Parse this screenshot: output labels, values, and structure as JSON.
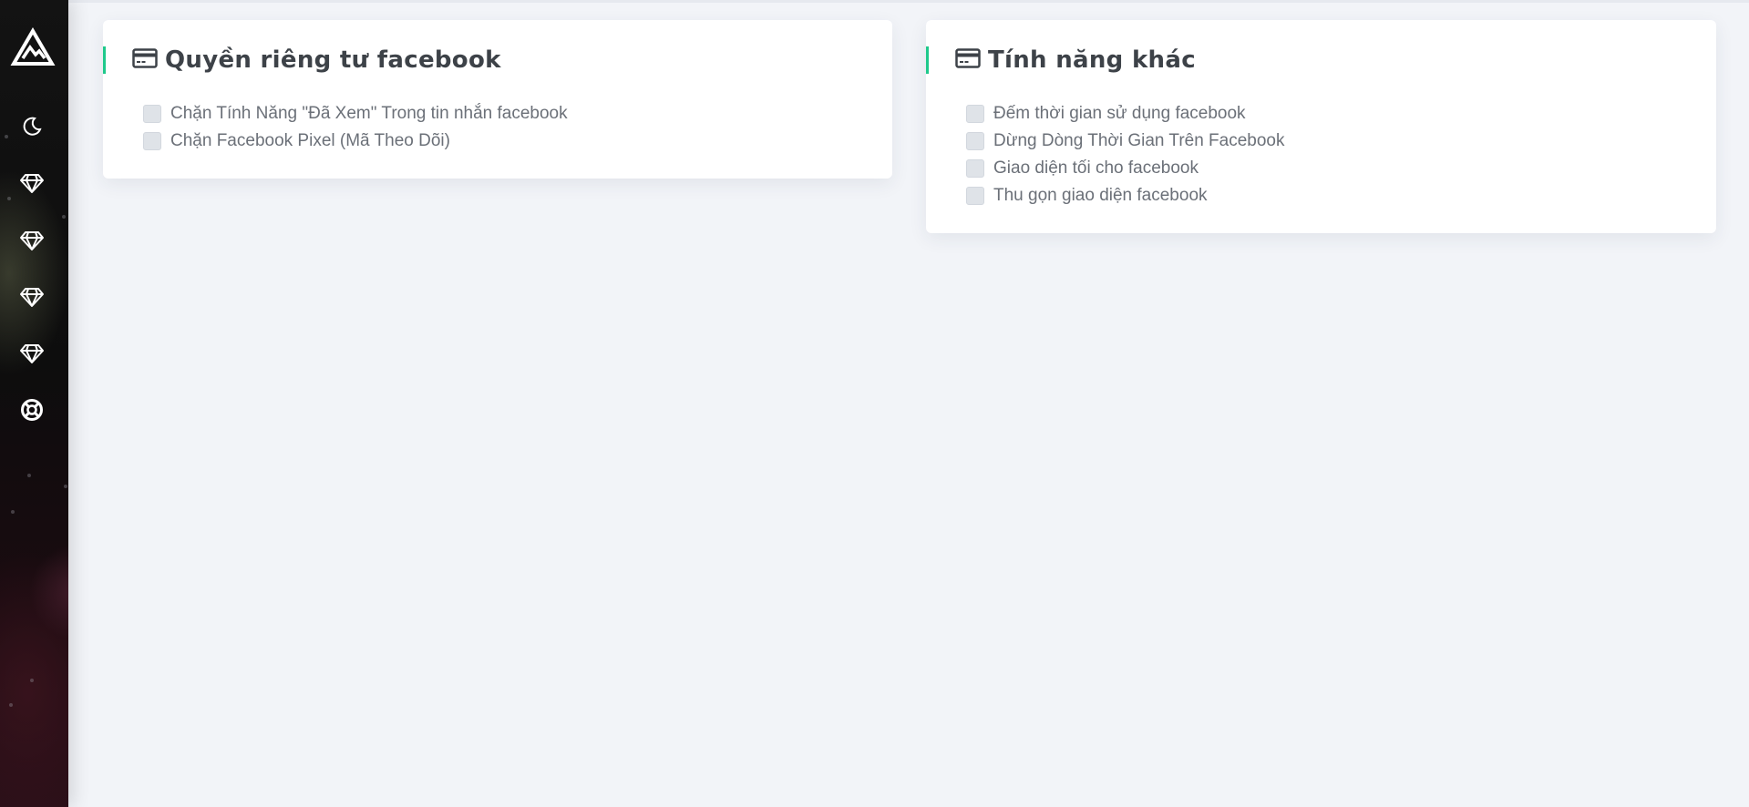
{
  "sidebar": {
    "icons": [
      {
        "name": "logo-mountain-icon"
      },
      {
        "name": "moon-icon"
      },
      {
        "name": "diamond-icon"
      },
      {
        "name": "diamond-icon"
      },
      {
        "name": "diamond-icon"
      },
      {
        "name": "diamond-icon"
      },
      {
        "name": "lifebuoy-icon"
      }
    ]
  },
  "privacy_card": {
    "title": "Quyền riêng tư facebook",
    "icon": "credit-card-icon",
    "options": [
      {
        "label": "Chặn Tính Năng \"Đã Xem\" Trong tin nhắn facebook",
        "checked": false
      },
      {
        "label": "Chặn Facebook Pixel (Mã Theo Dõi)",
        "checked": false
      }
    ]
  },
  "features_card": {
    "title": "Tính năng khác",
    "icon": "credit-card-icon",
    "options": [
      {
        "label": "Đếm thời gian sử dụng facebook",
        "checked": false
      },
      {
        "label": "Dừng Dòng Thời Gian Trên Facebook",
        "checked": false
      },
      {
        "label": "Giao diện tối cho facebook",
        "checked": false
      },
      {
        "label": "Thu gọn giao diện facebook",
        "checked": false
      }
    ]
  },
  "colors": {
    "accent": "#1ec98b",
    "background": "#f2f4f8",
    "sidebar": "#111111",
    "text": "#3d4248"
  }
}
